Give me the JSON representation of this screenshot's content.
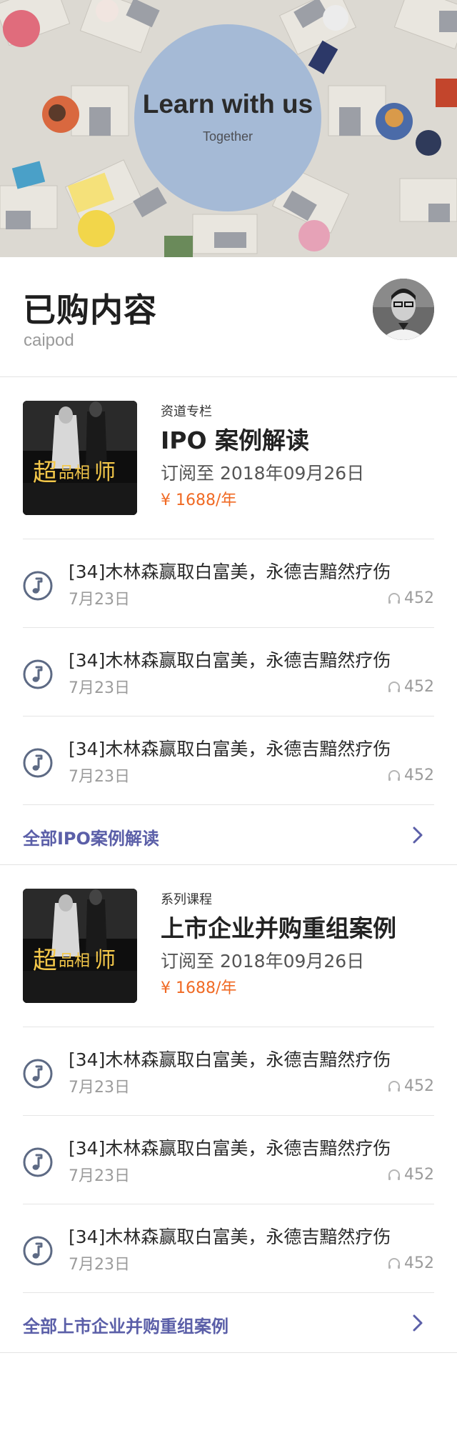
{
  "hero": {
    "title": "Learn with us",
    "subtitle": "Together"
  },
  "profile": {
    "title": "已购内容",
    "username": "caipod"
  },
  "colors": {
    "accent": "#5b5fa8",
    "price": "#f06a24",
    "icon": "#5d6a84",
    "circle": "#a5bad6"
  },
  "sections": [
    {
      "course": {
        "tag": "资道专栏",
        "title": "IPO 案例解读",
        "subscription": "订阅至 2018年09月26日",
        "price": "¥ 1688/年",
        "cover_icon": "book-cover-image"
      },
      "episodes": [
        {
          "title": "[34]木林森赢取白富美，永德吉黯然疗伤",
          "date": "7月23日",
          "plays": "452"
        },
        {
          "title": "[34]木林森赢取白富美，永德吉黯然疗伤",
          "date": "7月23日",
          "plays": "452"
        },
        {
          "title": "[34]木林森赢取白富美，永德吉黯然疗伤",
          "date": "7月23日",
          "plays": "452"
        }
      ],
      "more_label": "全部IPO案例解读"
    },
    {
      "course": {
        "tag": "系列课程",
        "title": "上市企业并购重组案例",
        "subscription": "订阅至 2018年09月26日",
        "price": "¥ 1688/年",
        "cover_icon": "book-cover-image"
      },
      "episodes": [
        {
          "title": "[34]木林森赢取白富美，永德吉黯然疗伤",
          "date": "7月23日",
          "plays": "452"
        },
        {
          "title": "[34]木林森赢取白富美，永德吉黯然疗伤",
          "date": "7月23日",
          "plays": "452"
        },
        {
          "title": "[34]木林森赢取白富美，永德吉黯然疗伤",
          "date": "7月23日",
          "plays": "452"
        }
      ],
      "more_label": "全部上市企业并购重组案例"
    }
  ],
  "icons": {
    "episode": "music-note-icon",
    "plays": "headphones-icon",
    "more": "chevron-right-icon"
  }
}
